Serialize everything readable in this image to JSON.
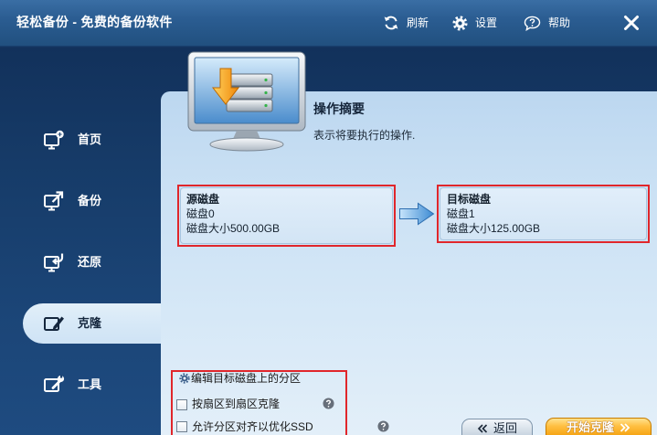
{
  "window": {
    "title": "轻松备份 - 免费的备份软件"
  },
  "toolbar": {
    "refresh": {
      "label": "刷新",
      "icon": "refresh-icon"
    },
    "settings": {
      "label": "设置",
      "icon": "gear-icon"
    },
    "help": {
      "label": "帮助",
      "icon": "help-bubble-icon"
    },
    "close_icon": "close-icon"
  },
  "sidebar": {
    "items": [
      {
        "label": "首页",
        "icon": "home-icon",
        "selected": false
      },
      {
        "label": "备份",
        "icon": "backup-icon",
        "selected": false
      },
      {
        "label": "还原",
        "icon": "restore-icon",
        "selected": false
      },
      {
        "label": "克隆",
        "icon": "clone-icon",
        "selected": true
      },
      {
        "label": "工具",
        "icon": "tools-icon",
        "selected": false
      }
    ]
  },
  "summary": {
    "title": "操作摘要",
    "subtitle": "表示将要执行的操作.",
    "icon": "disk-monitor-icon"
  },
  "source_disk": {
    "heading": "源磁盘",
    "name": "磁盘0",
    "size": "磁盘大小500.00GB"
  },
  "target_disk": {
    "heading": "目标磁盘",
    "name": "磁盘1",
    "size": "磁盘大小125.00GB"
  },
  "options": {
    "edit_partitions": {
      "label": "编辑目标磁盘上的分区",
      "icon": "gear-icon"
    },
    "sector_by_sector": {
      "label": "按扇区到扇区克隆",
      "checked": false,
      "help_icon": "question-icon"
    },
    "ssd_alignment": {
      "label": "允许分区对齐以优化SSD",
      "checked": false,
      "help_icon": "question-icon"
    }
  },
  "buttons": {
    "back": {
      "label": "返回",
      "icon": "double-chevron-left-icon"
    },
    "start": {
      "label": "开始克隆",
      "icon": "double-chevron-right-icon"
    }
  },
  "colors": {
    "highlight": "#e0262b",
    "accent": "#f6a516",
    "header": "#22507f",
    "panel": "#cfe3f5"
  }
}
